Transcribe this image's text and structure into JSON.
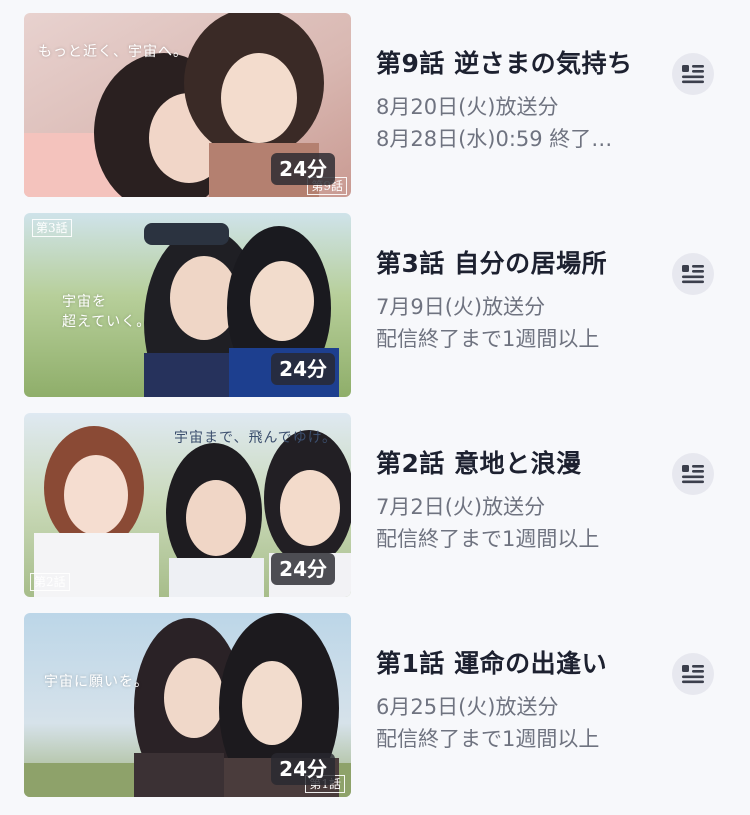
{
  "episodes": [
    {
      "title": "第9話 逆さまの気持ち",
      "air_date": "8月20日(火)放送分",
      "availability": "8月28日(水)0:59 終了…",
      "duration": "24分",
      "thumbnail": {
        "caption": "もっと近く、宇宙へ。",
        "episode_tag": "第9話"
      },
      "detail_icon": "list-detail-icon"
    },
    {
      "title": "第3話 自分の居場所",
      "air_date": "7月9日(火)放送分",
      "availability": "配信終了まで1週間以上",
      "duration": "24分",
      "thumbnail": {
        "caption_line1": "宇宙を",
        "caption_line2": "超えていく。",
        "episode_tag": "第3話"
      },
      "detail_icon": "list-detail-icon"
    },
    {
      "title": "第2話 意地と浪漫",
      "air_date": "7月2日(火)放送分",
      "availability": "配信終了まで1週間以上",
      "duration": "24分",
      "thumbnail": {
        "caption": "宇宙まで、飛んでゆけ。",
        "episode_tag": "第2話"
      },
      "detail_icon": "list-detail-icon"
    },
    {
      "title": "第1話 運命の出逢い",
      "air_date": "6月25日(火)放送分",
      "availability": "配信終了まで1週間以上",
      "duration": "24分",
      "thumbnail": {
        "caption": "宇宙に願いを。",
        "episode_tag": "第1話"
      },
      "detail_icon": "list-detail-icon"
    }
  ],
  "colors": {
    "background": "#f7f8fb",
    "title_text": "#1d2130",
    "meta_text": "#6f7380",
    "icon_button_bg": "#e7e8ef"
  }
}
